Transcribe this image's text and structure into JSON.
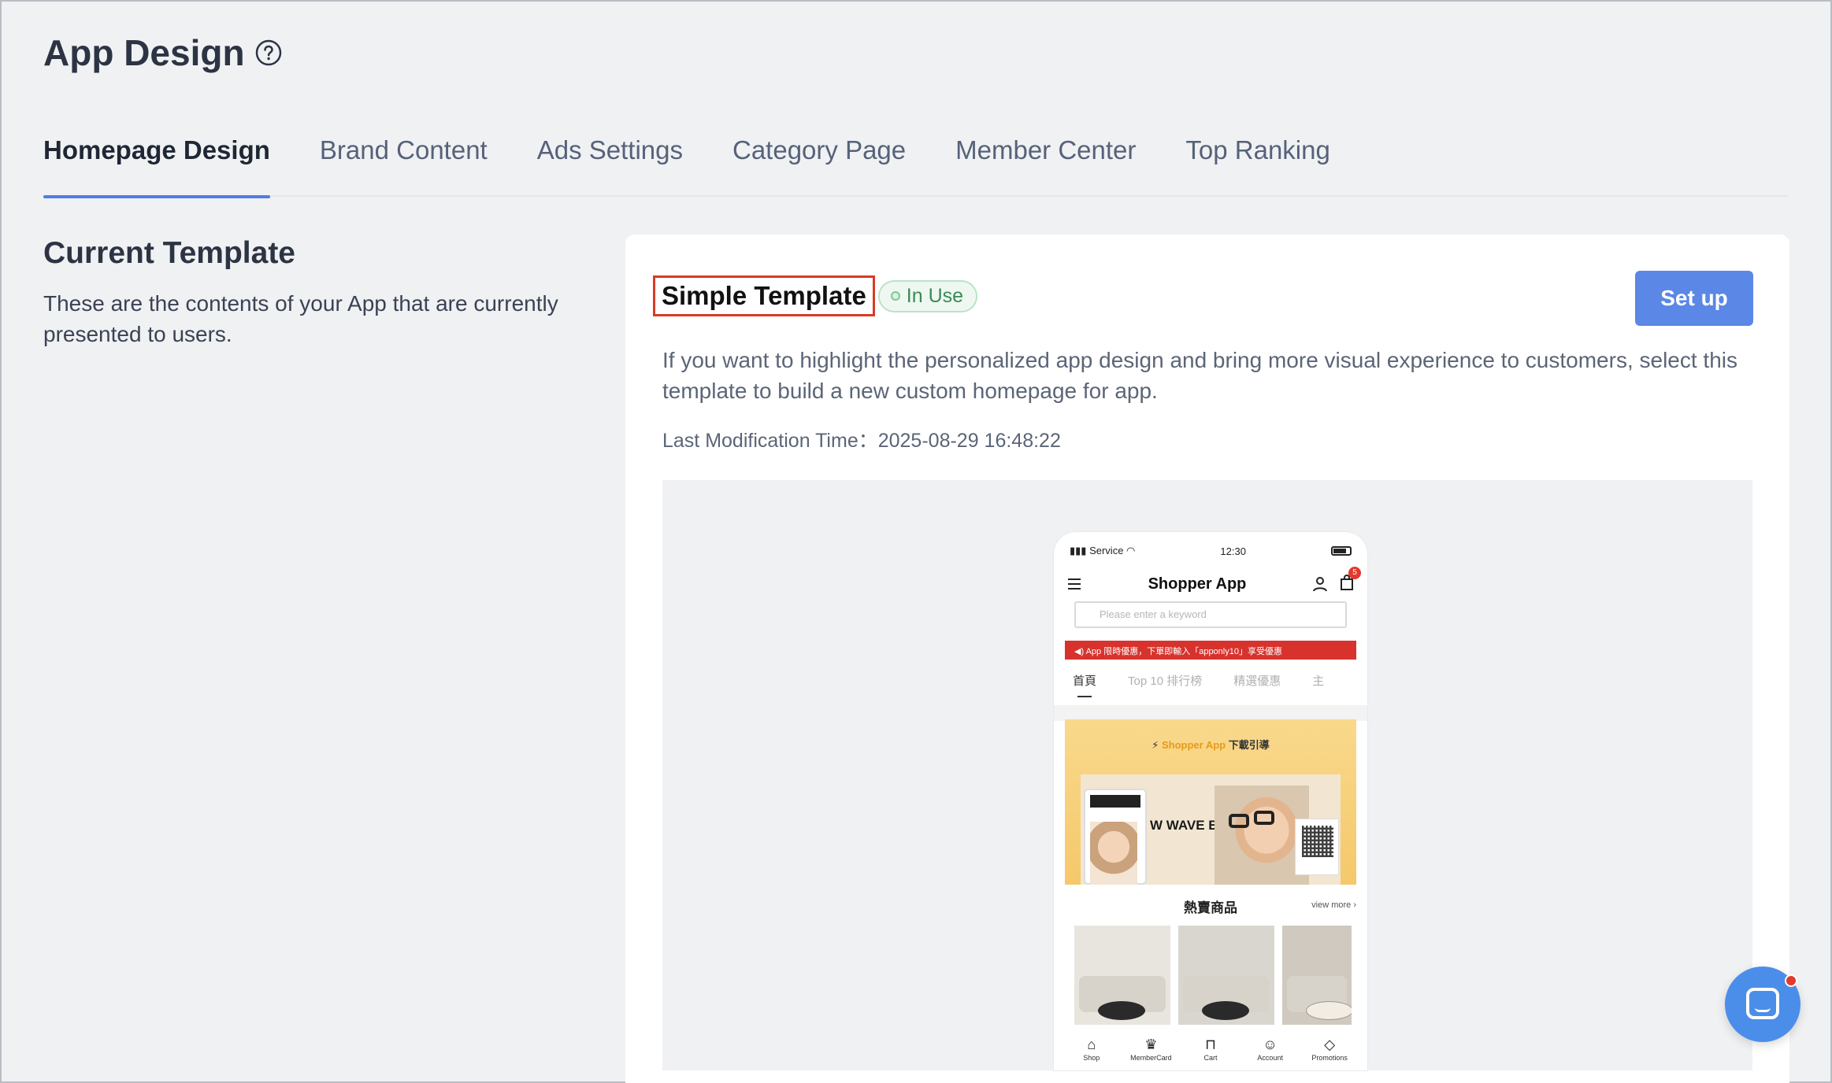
{
  "page": {
    "title": "App Design"
  },
  "tabs": [
    {
      "label": "Homepage Design",
      "active": true
    },
    {
      "label": "Brand Content"
    },
    {
      "label": "Ads Settings"
    },
    {
      "label": "Category Page"
    },
    {
      "label": "Member Center"
    },
    {
      "label": "Top Ranking"
    }
  ],
  "current": {
    "heading": "Current Template",
    "description": "These are the contents of your App that are currently presented to users."
  },
  "template": {
    "name": "Simple Template",
    "status": "In Use",
    "setup_label": "Set up",
    "description": "If you want to highlight the personalized app design and bring more visual experience to customers, select this template to build a new custom homepage for app.",
    "last_modified_label": "Last Modification Time：",
    "last_modified_value": "2025-08-29 16:48:22"
  },
  "preview": {
    "status_left": "Service",
    "time": "12:30",
    "app_title": "Shopper App",
    "cart_count": "5",
    "search_placeholder": "Please enter a keyword",
    "announcement": "App 限時優惠，下單即輸入「apponly10」享受優惠",
    "tabs": [
      "首頁",
      "Top 10 排行榜",
      "精選優惠",
      "主"
    ],
    "banner_brand": "Shopper App",
    "banner_title": "下載引導",
    "banner_text": "W WAVE EWEAR",
    "hot_title": "熱賣商品",
    "view_more": "view more ›",
    "bottom_nav": [
      {
        "label": "Shop",
        "icon": "home-icon"
      },
      {
        "label": "MemberCard",
        "icon": "crown-icon"
      },
      {
        "label": "Cart",
        "icon": "bag-icon"
      },
      {
        "label": "Account",
        "icon": "user-icon"
      },
      {
        "label": "Promotions",
        "icon": "tag-icon"
      }
    ]
  },
  "colors": {
    "accent": "#5b87e6",
    "highlight_border": "#d93a26",
    "badge_green": "#3a8a55",
    "announcement_red": "#d8322d"
  }
}
